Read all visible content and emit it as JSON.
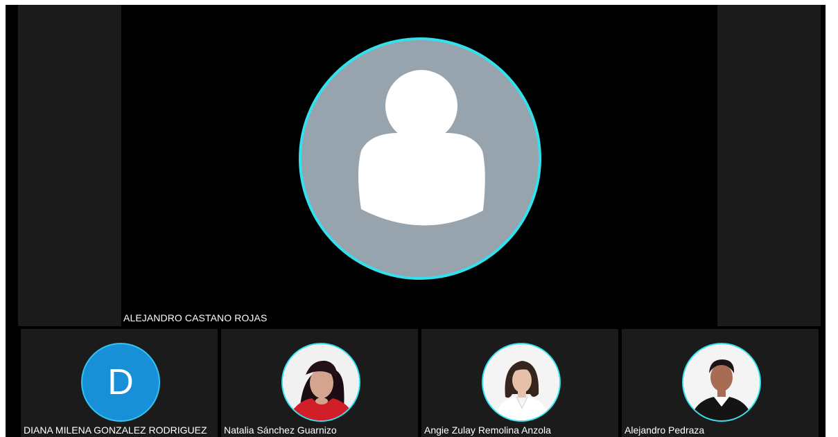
{
  "meeting": {
    "active_speaker": {
      "name": "ALEJANDRO CASTANO ROJAS",
      "avatar_icon": "default-person-icon",
      "ring_color": "#33e0ee"
    },
    "participants": [
      {
        "name": "DIANA MILENA GONZALEZ RODRIGUEZ",
        "initial": "D",
        "avatar_color": "#1790d8"
      },
      {
        "name": "Natalia Sánchez Guarnizo",
        "avatar_icon": "profile-photo"
      },
      {
        "name": "Angie Zulay Remolina Anzola",
        "avatar_icon": "profile-photo"
      },
      {
        "name": "Alejandro Pedraza",
        "avatar_icon": "profile-photo"
      }
    ]
  }
}
